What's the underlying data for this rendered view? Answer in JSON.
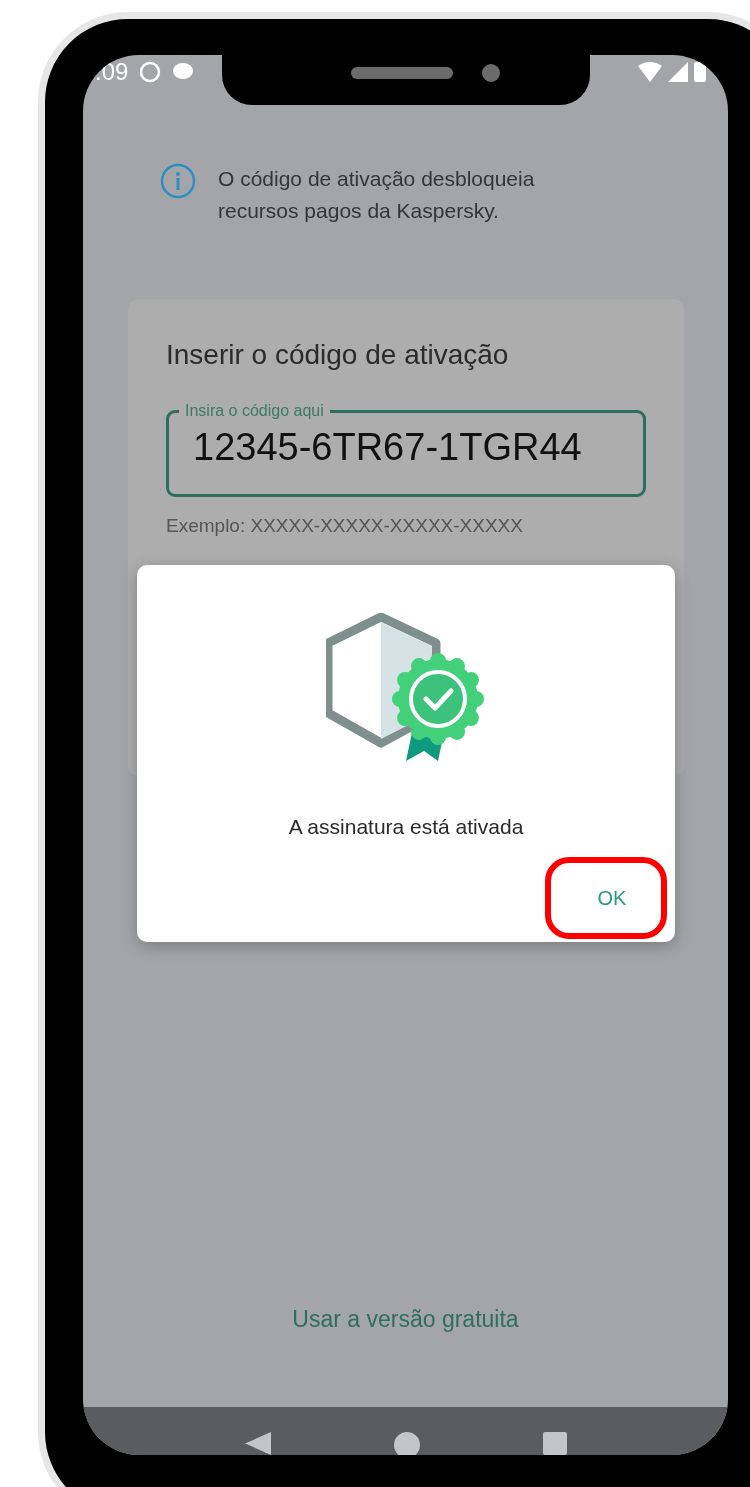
{
  "status_bar": {
    "time": ":09"
  },
  "info": {
    "text": "O código de ativação desbloqueia recursos pagos da Kaspersky."
  },
  "activation_card": {
    "title": "Inserir o código de ativação",
    "code_field": {
      "label": "Insira o código aqui",
      "value": "12345-6TR67-1TGR44"
    },
    "example": "Exemplo: XXXXX-XXXXX-XXXXX-XXXXX"
  },
  "dialog": {
    "message": "A assinatura está ativada",
    "button": "OK"
  },
  "free_version_link": "Usar a versão gratuita"
}
